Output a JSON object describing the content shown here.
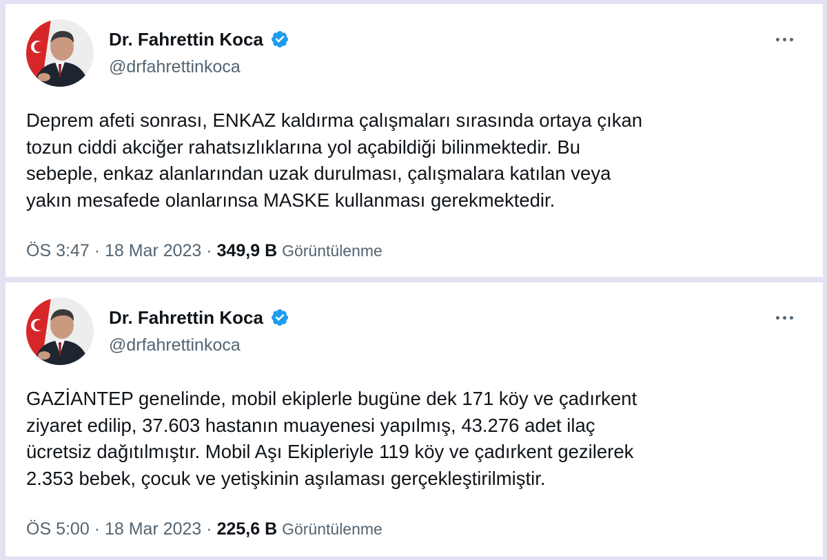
{
  "tweets": [
    {
      "author_name": "Dr. Fahrettin Koca",
      "handle": "@drfahrettinkoca",
      "verified_icon": "verified-badge-icon",
      "more_icon": "more-options-icon",
      "lines": [
        "Deprem afeti sonrası, ENKAZ kaldırma çalışmaları sırasında ortaya çıkan",
        "tozun ciddi akciğer rahatsızlıklarına yol açabildiği bilinmektedir. Bu",
        "sebeple, enkaz alanlarından uzak durulması, çalışmalara katılan veya",
        "yakın mesafede olanlarınsa MASKE kullanması gerekmektedir."
      ],
      "time": "ÖS 3:47",
      "date": "18 Mar 2023",
      "views": "349,9 B",
      "views_label": "Görüntülenme"
    },
    {
      "author_name": "Dr. Fahrettin Koca",
      "handle": "@drfahrettinkoca",
      "verified_icon": "verified-badge-icon",
      "more_icon": "more-options-icon",
      "lines": [
        "GAZİANTEP genelinde, mobil ekiplerle bugüne dek 171 köy ve çadırkent",
        "ziyaret edilip, 37.603 hastanın muayenesi yapılmış, 43.276 adet ilaç",
        "ücretsiz dağıtılmıştır. Mobil Aşı Ekipleriyle 119 köy ve çadırkent gezilerek",
        "2.353 bebek, çocuk ve yetişkinin aşılaması gerçekleştirilmiştir."
      ],
      "time": "ÖS 5:00",
      "date": "18 Mar 2023",
      "views": "225,6 B",
      "views_label": "Görüntülenme"
    }
  ],
  "meta_separator": "·",
  "colors": {
    "page_bg": "#e4e1f3",
    "card_bg": "#ffffff",
    "text_primary": "#0f1419",
    "text_secondary": "#536471",
    "verified_blue": "#1d9bf0"
  }
}
